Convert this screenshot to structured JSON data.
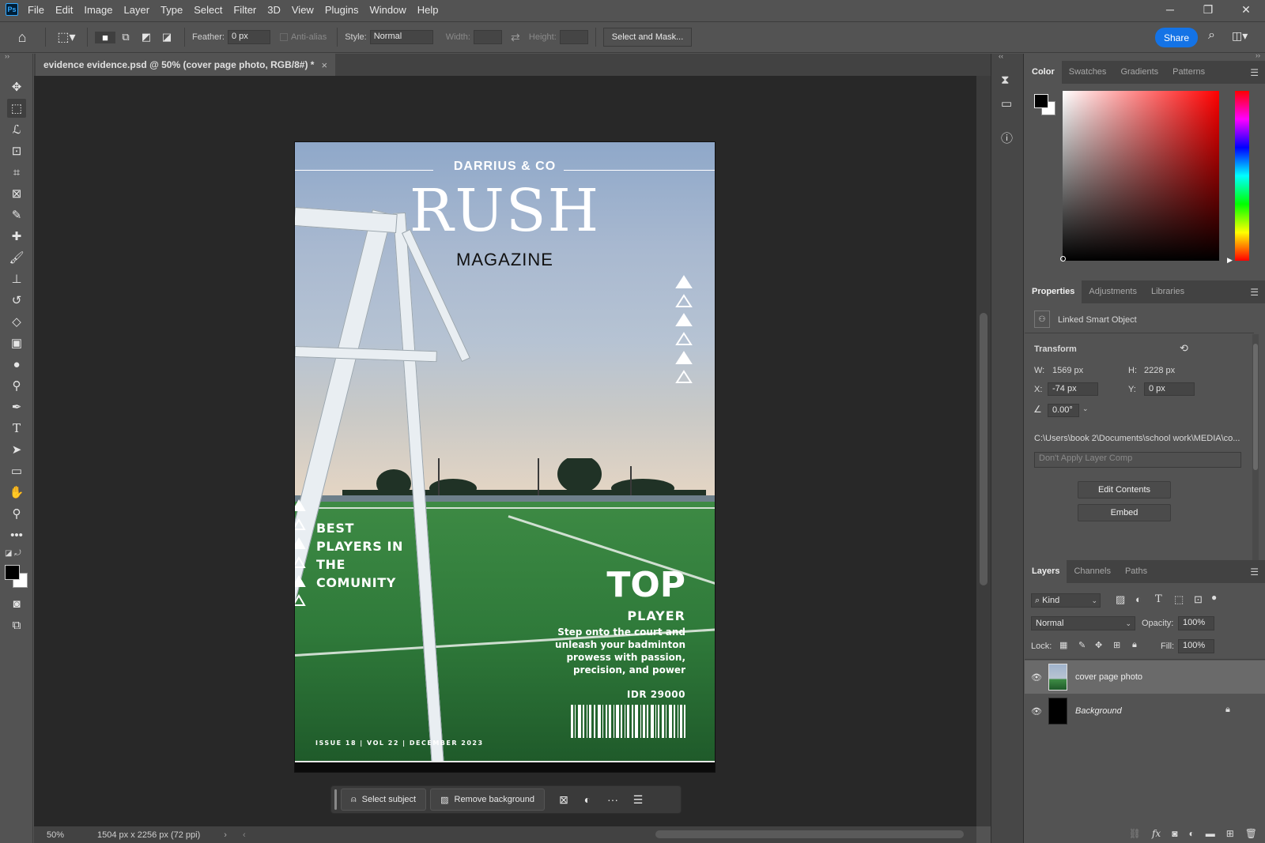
{
  "app": {
    "logo": "Ps"
  },
  "menu": [
    "File",
    "Edit",
    "Image",
    "Layer",
    "Type",
    "Select",
    "Filter",
    "3D",
    "View",
    "Plugins",
    "Window",
    "Help"
  ],
  "window_controls": {
    "minimize": "─",
    "restore": "❐",
    "close": "✕"
  },
  "options_bar": {
    "feather_label": "Feather:",
    "feather_value": "0 px",
    "antialias_label": "Anti-alias",
    "style_label": "Style:",
    "style_value": "Normal",
    "width_label": "Width:",
    "height_label": "Height:",
    "select_and_mask": "Select and Mask...",
    "share": "Share"
  },
  "document": {
    "tab_title": "evidence evidence.psd @ 50% (cover page photo, RGB/8#) *",
    "close": "×"
  },
  "magazine": {
    "brand": "DARRIUS & CO",
    "title": "RUSH",
    "subtitle": "MAGAZINE",
    "best_lines": [
      "BEST",
      "PLAYERS IN",
      "THE",
      "COMUNITY"
    ],
    "top": "TOP",
    "player": "PLAYER",
    "tagline_lines": [
      "Step onto the court and",
      "unleash your badminton",
      "prowess with passion,",
      "precision, and power"
    ],
    "price": "IDR 29000",
    "issue": "ISSUE 18  |  VOL 22  |  DECEMBER 2023"
  },
  "taskbar": {
    "select_subject": "Select subject",
    "remove_background": "Remove background",
    "more": "···"
  },
  "status": {
    "zoom": "50%",
    "doc_info": "1504 px x 2256 px (72 ppi)"
  },
  "color_panel": {
    "tabs": [
      "Color",
      "Swatches",
      "Gradients",
      "Patterns"
    ],
    "active_tab": "Color",
    "hue_color": "#ff0000",
    "foreground": "#000000",
    "background": "#ffffff"
  },
  "properties_panel": {
    "tabs": [
      "Properties",
      "Adjustments",
      "Libraries"
    ],
    "active_tab": "Properties",
    "object_type": "Linked Smart Object",
    "transform_label": "Transform",
    "w_label": "W:",
    "w_value": "1569 px",
    "h_label": "H:",
    "h_value": "2228 px",
    "x_label": "X:",
    "x_value": "-74 px",
    "y_label": "Y:",
    "y_value": "0 px",
    "angle_value": "0.00°",
    "path": "C:\\Users\\book 2\\Documents\\school work\\MEDIA\\co...",
    "layer_comp": "Don't Apply Layer Comp",
    "edit_contents": "Edit Contents",
    "embed": "Embed"
  },
  "layers_panel": {
    "tabs": [
      "Layers",
      "Channels",
      "Paths"
    ],
    "active_tab": "Layers",
    "kind": "Kind",
    "blend_mode": "Normal",
    "opacity_label": "Opacity:",
    "opacity_value": "100%",
    "lock_label": "Lock:",
    "fill_label": "Fill:",
    "fill_value": "100%",
    "layers": [
      {
        "name": "cover page photo",
        "selected": true
      },
      {
        "name": "Background",
        "selected": false,
        "locked": true
      }
    ]
  }
}
